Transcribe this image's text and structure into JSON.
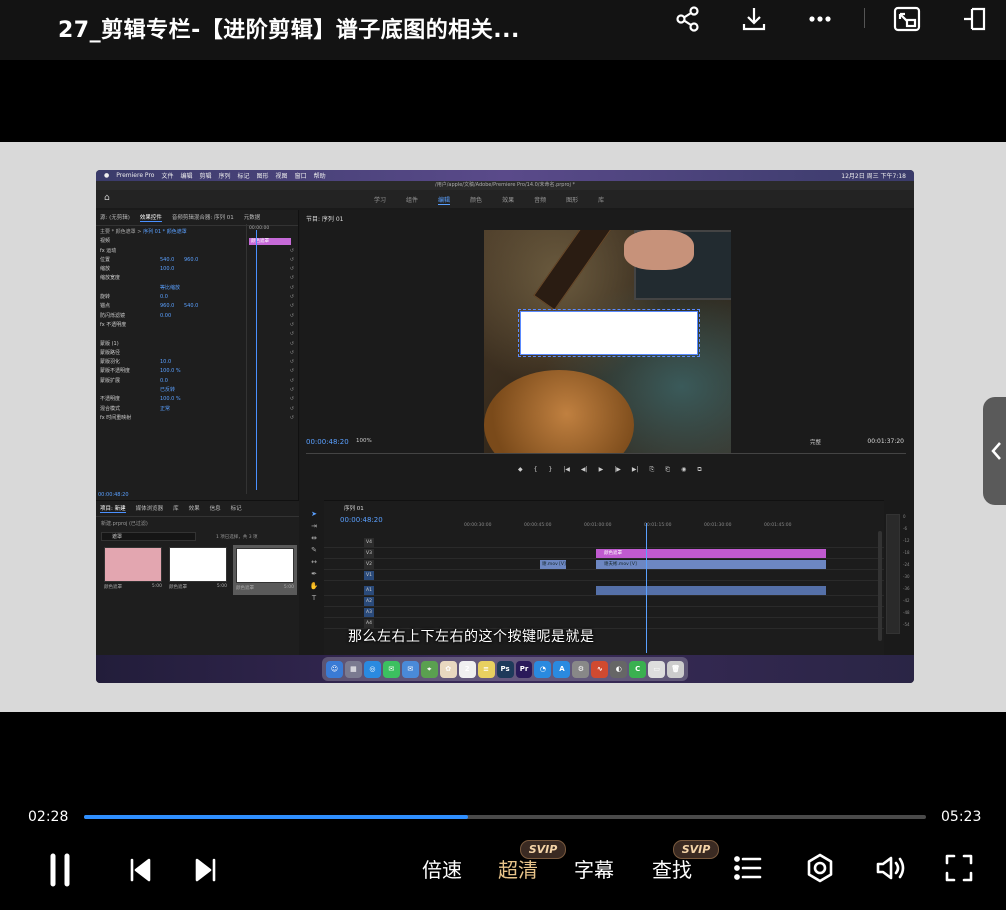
{
  "header": {
    "title": "27_剪辑专栏-【进阶剪辑】谱子底图的相关..."
  },
  "premiere": {
    "menubar": [
      "Premiere Pro",
      "文件",
      "编辑",
      "剪辑",
      "序列",
      "标记",
      "图形",
      "视图",
      "窗口",
      "帮助"
    ],
    "menubar_clock": "12月2日 周三 下午7:18",
    "window_title": "/用户/apple/文稿/Adobe/Premiere Pro/14.0/未命名.prproj *",
    "workspaces": [
      "学习",
      "组件",
      "编辑",
      "颜色",
      "效果",
      "音频",
      "图形",
      "库"
    ],
    "effect_controls": {
      "tabs": [
        "源: (无剪辑)",
        "效果控件",
        "音频剪辑混合器: 序列 01",
        "元数据"
      ],
      "master_label": "主要 * 颜色遮罩",
      "clip_label": "序列 01 * 颜色遮罩",
      "section": "视频",
      "rows": [
        {
          "label": "fx 运动",
          "v1": "",
          "v2": ""
        },
        {
          "label": "位置",
          "v1": "540.0",
          "v2": "960.0"
        },
        {
          "label": "缩放",
          "v1": "100.0",
          "v2": ""
        },
        {
          "label": "缩放宽度",
          "v1": "",
          "v2": ""
        },
        {
          "label": "",
          "v1": "等比缩放",
          "v2": ""
        },
        {
          "label": "旋转",
          "v1": "0.0",
          "v2": ""
        },
        {
          "label": "锚点",
          "v1": "960.0",
          "v2": "540.0"
        },
        {
          "label": "防闪烁滤镜",
          "v1": "0.00",
          "v2": ""
        },
        {
          "label": "fx 不透明度",
          "v1": "",
          "v2": ""
        },
        {
          "label": "",
          "v1": "",
          "v2": ""
        },
        {
          "label": "蒙版 (1)",
          "v1": "",
          "v2": ""
        },
        {
          "label": "蒙版路径",
          "v1": "",
          "v2": ""
        },
        {
          "label": "蒙版羽化",
          "v1": "10.0",
          "v2": ""
        },
        {
          "label": "蒙版不透明度",
          "v1": "100.0 %",
          "v2": ""
        },
        {
          "label": "蒙版扩展",
          "v1": "0.0",
          "v2": ""
        },
        {
          "label": "",
          "v1": "已反转",
          "v2": ""
        },
        {
          "label": "不透明度",
          "v1": "100.0 %",
          "v2": ""
        },
        {
          "label": "混合模式",
          "v1": "正常",
          "v2": ""
        },
        {
          "label": "fx 时间重映射",
          "v1": "",
          "v2": ""
        }
      ],
      "clip_name": "颜色遮罩",
      "timecode": "00:00:00",
      "current_time": "00:00:48:20"
    },
    "program": {
      "tab": "节目: 序列 01",
      "timecode": "00:00:48:20",
      "zoom": "100%",
      "fit": "完整",
      "duration": "00:01:37:20",
      "controls": [
        "◆",
        "{",
        "}",
        "|◀",
        "◀|",
        "▶",
        "|▶",
        "▶|",
        "⎘",
        "⎗",
        "◉",
        "⧉"
      ]
    },
    "project": {
      "tabs": [
        "项目: 新建",
        "媒体浏览器",
        "库",
        "效果",
        "信息",
        "标记"
      ],
      "path": "新建.prproj (已过滤)",
      "search_value": "遮罩",
      "count": "1 项已选择，共 3 项",
      "items": [
        {
          "name": "颜色遮罩",
          "dur": "5:00",
          "color": "#e3a6b0"
        },
        {
          "name": "颜色遮罩",
          "dur": "5:00",
          "color": "#ffffff"
        },
        {
          "name": "颜色遮罩",
          "dur": "5:00",
          "color": "#ffffff"
        }
      ]
    },
    "timeline": {
      "tab": "序列 01",
      "timecode": "00:00:48:20",
      "ruler": [
        "00:00:30:00",
        "00:00:45:00",
        "00:01:00:00",
        "00:01:15:00",
        "00:01:30:00",
        "00:01:45:00"
      ],
      "tracks": [
        "V4",
        "V3",
        "V2",
        "V1",
        "A1",
        "A2",
        "A3",
        "A4"
      ],
      "clips": {
        "pink": "颜色遮罩",
        "blue": "谢夫彬.mov [V]",
        "small": "谢.mov [V]"
      }
    },
    "meter_scale": [
      "0",
      "-6",
      "-12",
      "-18",
      "-24",
      "-30",
      "-36",
      "-42",
      "-48",
      "-54"
    ],
    "dock_icons": [
      {
        "name": "finder-icon",
        "color": "#3a7bd5",
        "glyph": "☺"
      },
      {
        "name": "launchpad-icon",
        "color": "#7a7a90",
        "glyph": "▦"
      },
      {
        "name": "safari-icon",
        "color": "#2a8ae0",
        "glyph": "◎"
      },
      {
        "name": "messages-icon",
        "color": "#3cc060",
        "glyph": "✉"
      },
      {
        "name": "mail-icon",
        "color": "#4a8ad8",
        "glyph": "✉"
      },
      {
        "name": "maps-icon",
        "color": "#5aa050",
        "glyph": "⌖"
      },
      {
        "name": "photos-icon",
        "color": "#e8d8c0",
        "glyph": "✿"
      },
      {
        "name": "calendar-icon",
        "color": "#f0f0f0",
        "glyph": "2"
      },
      {
        "name": "notes-icon",
        "color": "#e8d060",
        "glyph": "≡"
      },
      {
        "name": "photoshop-icon",
        "color": "#1e3a5a",
        "glyph": "Ps"
      },
      {
        "name": "premiere-icon",
        "color": "#2a1a5a",
        "glyph": "Pr"
      },
      {
        "name": "qq-icon",
        "color": "#2a8ae0",
        "glyph": "◔"
      },
      {
        "name": "appstore-icon",
        "color": "#2a8ae0",
        "glyph": "A"
      },
      {
        "name": "settings-icon",
        "color": "#888",
        "glyph": "⚙"
      },
      {
        "name": "waveform-icon",
        "color": "#d04a30",
        "glyph": "∿"
      },
      {
        "name": "utility-icon",
        "color": "#666",
        "glyph": "◐"
      },
      {
        "name": "codeapp-icon",
        "color": "#3ab050",
        "glyph": "C"
      },
      {
        "name": "preview-icon",
        "color": "#ddd",
        "glyph": "▭"
      },
      {
        "name": "trash-icon",
        "color": "#ccc",
        "glyph": "🗑"
      }
    ]
  },
  "subtitle": "那么左右上下左右的这个按键呢是就是",
  "player": {
    "current_time": "02:28",
    "total_time": "05:23",
    "progress": 0.456,
    "speed_label": "倍速",
    "quality_label": "超清",
    "caption_label": "字幕",
    "find_label": "查找",
    "svip_badge": "SVIP"
  }
}
